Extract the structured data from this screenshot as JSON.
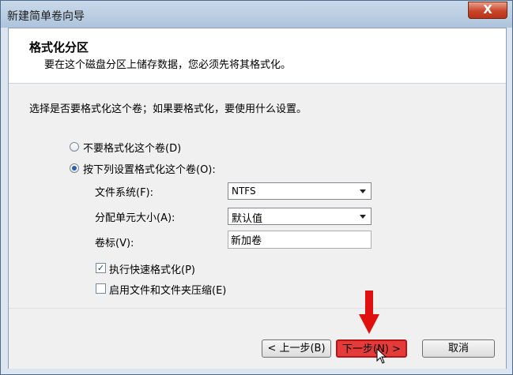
{
  "window": {
    "title": "新建简单卷向导",
    "close_label": "X"
  },
  "header": {
    "title": "格式化分区",
    "subtitle": "要在这个磁盘分区上储存数据，您必须先将其格式化。"
  },
  "body": {
    "prompt": "选择是否要格式化这个卷；如果要格式化，要使用什么设置。",
    "radio_no_format": "不要格式化这个卷(D)",
    "radio_format": "按下列设置格式化这个卷(O):",
    "fs_label": "文件系统(F):",
    "fs_value": "NTFS",
    "alloc_label": "分配单元大小(A):",
    "alloc_value": "默认值",
    "volume_label": "卷标(V):",
    "volume_value": "新加卷",
    "quick_format": "执行快速格式化(P)",
    "compress": "启用文件和文件夹压缩(E)",
    "quick_format_checked": true,
    "compress_checked": false,
    "selected_radio": "format"
  },
  "footer": {
    "back": "< 上一步(B)",
    "next": "下一步(N) >",
    "cancel": "取消"
  },
  "colors": {
    "highlight": "#e53a3a",
    "annotation_arrow": "#e01010"
  },
  "icons": {
    "close": "close-icon",
    "annotation": "red-arrow-down-icon",
    "cursor": "mouse-pointer-icon"
  }
}
